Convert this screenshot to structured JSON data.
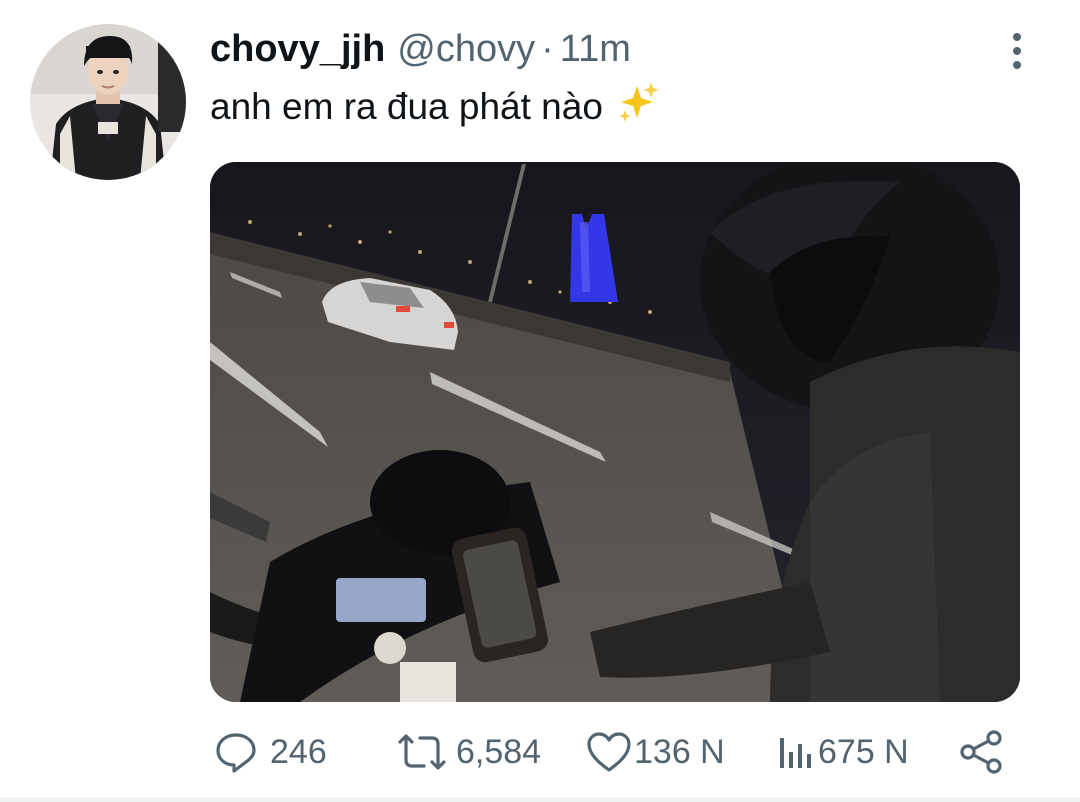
{
  "tweet": {
    "display_name": "chovy_jjh",
    "handle": "@chovy",
    "separator": "·",
    "time": "11m",
    "text": "anh em ra đua phát nào"
  },
  "icons": {
    "sparkles": "sparkles-icon",
    "more": "more-vertical-icon",
    "reply": "reply-icon",
    "retweet": "retweet-icon",
    "like": "like-icon",
    "views": "views-icon",
    "share": "share-icon"
  },
  "actions": {
    "reply_count": "246",
    "retweet_count": "6,584",
    "like_count": "136 N",
    "views_count": "675 N"
  },
  "colors": {
    "text_primary": "#0f1419",
    "text_secondary": "#536471",
    "sparkle": "#f5c518"
  }
}
